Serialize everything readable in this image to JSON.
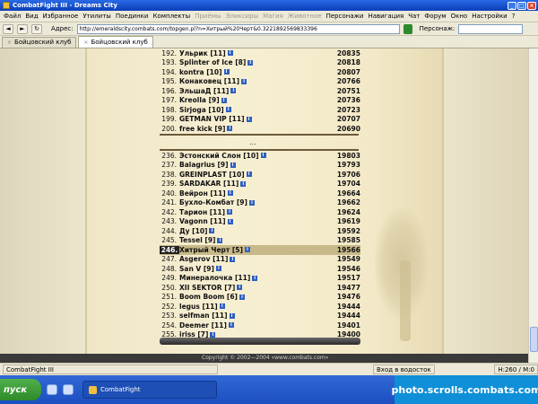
{
  "window": {
    "title": "CombatFight III - Dreams City"
  },
  "menu": [
    "Файл",
    "Вид",
    "Избранное",
    "Утилиты",
    "Поединки",
    "Комплекты",
    "Приёмы",
    "Эликсиры",
    "Магия",
    "Животное",
    "Персонажи",
    "Навигация",
    "Чат",
    "Форум",
    "Окно",
    "Настройки",
    "?"
  ],
  "address": {
    "label": "Адрес:",
    "url": "http://emeraldscity.combats.com/topgen.pl?n=Хитрый%20Черт&0.3221892569833396",
    "persona_label": "Персонаж:"
  },
  "tabs": [
    {
      "label": "Бойцовский клуб"
    },
    {
      "label": "Бойцовский клуб"
    }
  ],
  "rows_top": [
    {
      "num": "192.",
      "name": "Ульрик [11]",
      "score": "20835"
    },
    {
      "num": "193.",
      "name": "Splinter of Ice [8]",
      "score": "20818"
    },
    {
      "num": "194.",
      "name": "kontra [10]",
      "score": "20807"
    },
    {
      "num": "195.",
      "name": "Конаковец [11]",
      "score": "20766"
    },
    {
      "num": "196.",
      "name": "ЭльшаД [11]",
      "score": "20751"
    },
    {
      "num": "197.",
      "name": "Kreolla [9]",
      "score": "20736"
    },
    {
      "num": "198.",
      "name": "Sirjoga [10]",
      "score": "20723"
    },
    {
      "num": "199.",
      "name": "GETMAN VIP [11]",
      "score": "20707"
    },
    {
      "num": "200.",
      "name": "free kick [9]",
      "score": "20690"
    }
  ],
  "ellipsis": "...",
  "rows_bottom": [
    {
      "num": "236.",
      "name": "Эстонский Слон [10]",
      "score": "19803"
    },
    {
      "num": "237.",
      "name": "Balagrius [9]",
      "score": "19793"
    },
    {
      "num": "238.",
      "name": "GREINPLAST [10]",
      "score": "19706"
    },
    {
      "num": "239.",
      "name": "SARDAKAR [11]",
      "score": "19704"
    },
    {
      "num": "240.",
      "name": "Вейрон [11]",
      "score": "19664"
    },
    {
      "num": "241.",
      "name": "Бухло-Комбат [9]",
      "score": "19662"
    },
    {
      "num": "242.",
      "name": "Тарион [11]",
      "score": "19624"
    },
    {
      "num": "243.",
      "name": "Vagonn [11]",
      "score": "19619"
    },
    {
      "num": "244.",
      "name": "Ду [10]",
      "score": "19592"
    },
    {
      "num": "245.",
      "name": "Tessel [9]",
      "score": "19585"
    },
    {
      "num": "246.",
      "name": "Хитрый Черт [5]",
      "score": "19566",
      "highlight": true
    },
    {
      "num": "247.",
      "name": "Asgerov [11]",
      "score": "19549"
    },
    {
      "num": "248.",
      "name": "San V [9]",
      "score": "19546"
    },
    {
      "num": "249.",
      "name": "Минералочка [11]",
      "score": "19517"
    },
    {
      "num": "250.",
      "name": "XII SEKTOR [7]",
      "score": "19477"
    },
    {
      "num": "251.",
      "name": "Boom Boom [6]",
      "score": "19476"
    },
    {
      "num": "252.",
      "name": "legus [11]",
      "score": "19444"
    },
    {
      "num": "253.",
      "name": "selfman [11]",
      "score": "19444"
    },
    {
      "num": "254.",
      "name": "Deemer [11]",
      "score": "19401"
    },
    {
      "num": "255.",
      "name": "iriss [7]",
      "score": "19400"
    }
  ],
  "footer": {
    "copyright": "Copyright © 2002—2004 «www.combats.com»"
  },
  "status": {
    "left": "CombatFight III",
    "room": "Вход в водосток",
    "hp": "H:260 / M:0"
  },
  "taskbar": {
    "start": "пуск",
    "task": "CombatFight",
    "tray": "photo.scrolls.combats.com"
  }
}
